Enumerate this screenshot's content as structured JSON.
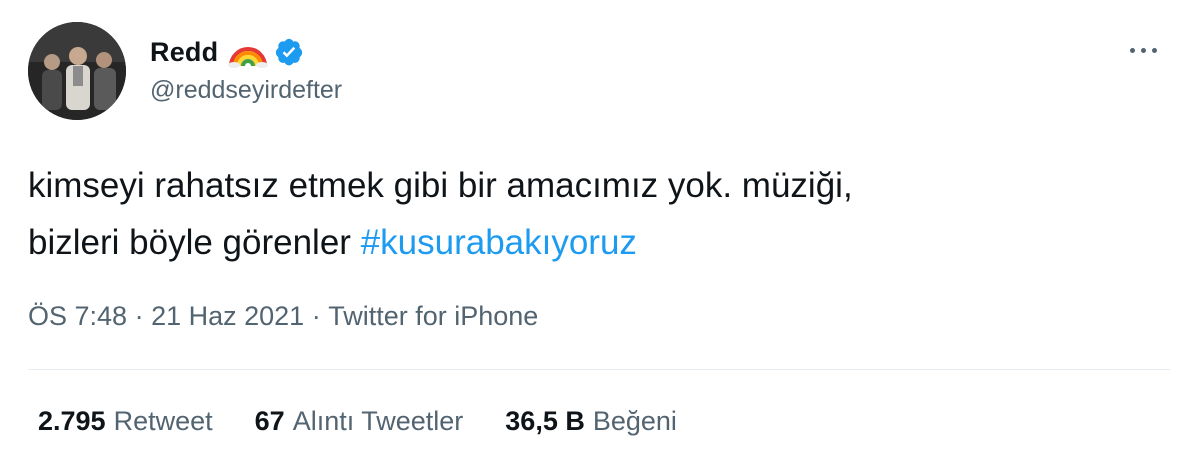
{
  "author": {
    "name": "Redd",
    "handle": "@reddseyirdefter",
    "badges": [
      "rainbow-emoji",
      "verified-badge-icon"
    ],
    "verified_color": "#1d9bf0"
  },
  "tweet": {
    "text_line1": "kimseyi rahatsız etmek gibi bir amacımız yok. müziği,",
    "text_line2": "bizleri böyle görenler ",
    "hashtag": "#kusurabakıyoruz",
    "hashtag_color": "#1d9bf0"
  },
  "meta": {
    "time": "ÖS 7:48",
    "sep1": " · ",
    "date": "21 Haz 2021",
    "sep2": " · ",
    "source": "Twitter for iPhone"
  },
  "stats": [
    {
      "value": "2.795",
      "label": "Retweet"
    },
    {
      "value": "67",
      "label": "Alıntı Tweetler"
    },
    {
      "value": "36,5 B",
      "label": "Beğeni"
    }
  ],
  "menu": {
    "icon": "more-horizontal-icon"
  }
}
